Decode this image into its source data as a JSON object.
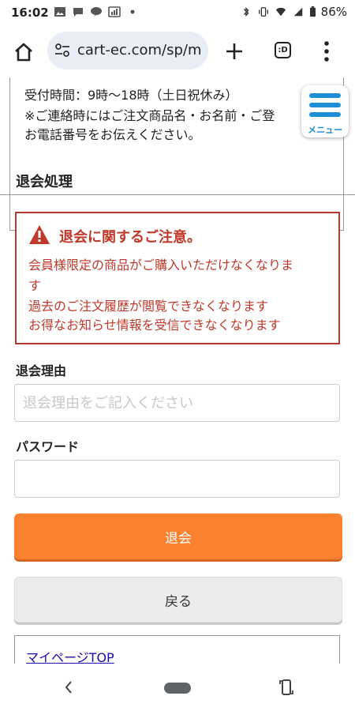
{
  "status_bar": {
    "time": "16:02",
    "battery": "86%"
  },
  "browser": {
    "url": "cart-ec.com/sp/m",
    "tabs_label": ":D"
  },
  "contact": {
    "lines": [
      "受付時間：9時〜18時（土日祝休み）",
      "※ご連絡時にはご注文商品名・お名前・ご登",
      "お電話番号をお伝えください。"
    ]
  },
  "menu": {
    "label": "メニュー"
  },
  "page": {
    "section_title": "退会処理"
  },
  "warning": {
    "title": "退会に関するご注意。",
    "messages": [
      "会員様限定の商品がご購入いただけなくなりま",
      "す",
      "過去のご注文履歴が閲覧できなくなります",
      "お得なお知らせ情報を受信できなくなります"
    ]
  },
  "form": {
    "reason_label": "退会理由",
    "reason_placeholder": "退会理由をご記入ください",
    "password_label": "パスワード",
    "password_value": "",
    "submit_label": "退会",
    "back_label": "戻る"
  },
  "links": {
    "mypage_top": "マイページTOP"
  },
  "colors": {
    "accent_orange": "#fb8130",
    "warning_red": "#c0392b",
    "menu_blue": "#1e8fd6"
  }
}
